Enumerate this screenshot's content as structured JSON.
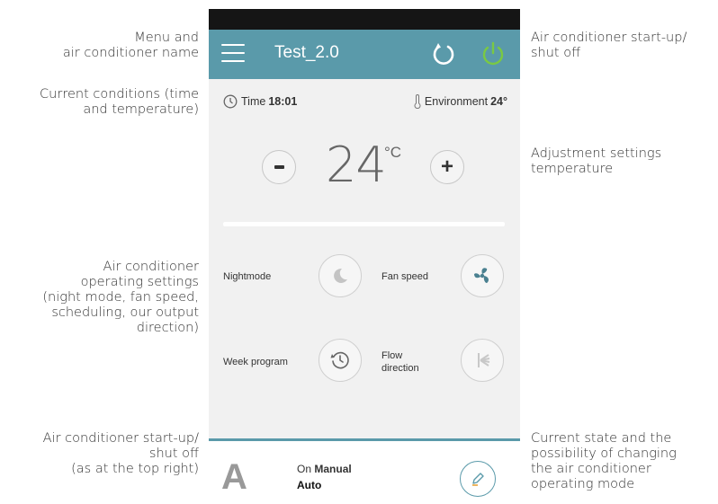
{
  "annotations": {
    "menu_name": [
      "Menu and",
      "air conditioner name"
    ],
    "current_conditions": [
      "Current conditions (time",
      "and temperature)"
    ],
    "operating_settings": [
      "Air conditioner",
      "operating settings",
      "(night mode, fan speed,",
      "scheduling, our output",
      "direction)"
    ],
    "bottom_power": [
      "Air conditioner start-up/",
      "shut off",
      "(as at the top right)"
    ],
    "top_power": [
      "Air conditioner start-up/",
      "shut off"
    ],
    "adjust_temp": [
      "Adjustment settings",
      "temperature"
    ],
    "current_state": [
      "Current state and the",
      "possibility of changing",
      "the air conditioner",
      "operating mode"
    ]
  },
  "app": {
    "title": "Test_2.0",
    "colors": {
      "accent": "#5a9aaa",
      "power_on": "#7ac943"
    }
  },
  "conditions": {
    "time_label": "Time",
    "time_value": "18:01",
    "env_label": "Environment",
    "env_value": "24°"
  },
  "temperature": {
    "value": "24",
    "unit": "°C",
    "minus_label": "-",
    "plus_label": "+"
  },
  "settings": {
    "nightmode": "Nightmode",
    "fan_speed": "Fan speed",
    "week_program": "Week program",
    "flow_direction_1": "Flow",
    "flow_direction_2": "direction"
  },
  "state": {
    "mode_letter": "A",
    "line1_prefix": "On",
    "line1_value": "Manual",
    "line2": "Auto"
  }
}
